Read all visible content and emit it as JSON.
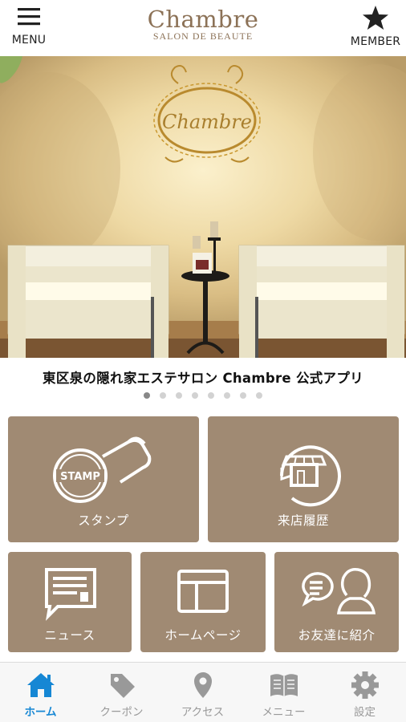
{
  "header": {
    "menu_label": "MENU",
    "member_label": "MEMBER",
    "logo_name": "Chambre",
    "logo_sub": "SALON DE BEAUTE"
  },
  "hero": {
    "image": "salon interior with two white armchairs and gold framed Chambre sign",
    "sign_text": "Chambre"
  },
  "caption": "東区泉の隠れ家エステサロン Chambre 公式アプリ",
  "carousel": {
    "page_count": 8,
    "active_index": 0
  },
  "tiles": [
    {
      "key": "stamp",
      "label": "スタンプ",
      "stamp_text": "STAMP",
      "icon": "stamp-icon"
    },
    {
      "key": "visit",
      "label": "来店履歴",
      "icon": "shop-history-icon"
    },
    {
      "key": "news",
      "label": "ニュース",
      "icon": "news-icon"
    },
    {
      "key": "homepage",
      "label": "ホームページ",
      "icon": "browser-icon"
    },
    {
      "key": "friend",
      "label": "お友達に紹介",
      "icon": "refer-friend-icon"
    }
  ],
  "tabbar": [
    {
      "label": "ホーム",
      "icon": "home-icon",
      "active": true
    },
    {
      "label": "クーポン",
      "icon": "tag-icon",
      "active": false
    },
    {
      "label": "アクセス",
      "icon": "map-pin-icon",
      "active": false
    },
    {
      "label": "メニュー",
      "icon": "book-icon",
      "active": false
    },
    {
      "label": "設定",
      "icon": "gear-icon",
      "active": false
    }
  ],
  "colors": {
    "tile": "#a08a73",
    "brand": "#8c7257",
    "active_tab": "#1687d4",
    "inactive_tab": "#999999"
  }
}
